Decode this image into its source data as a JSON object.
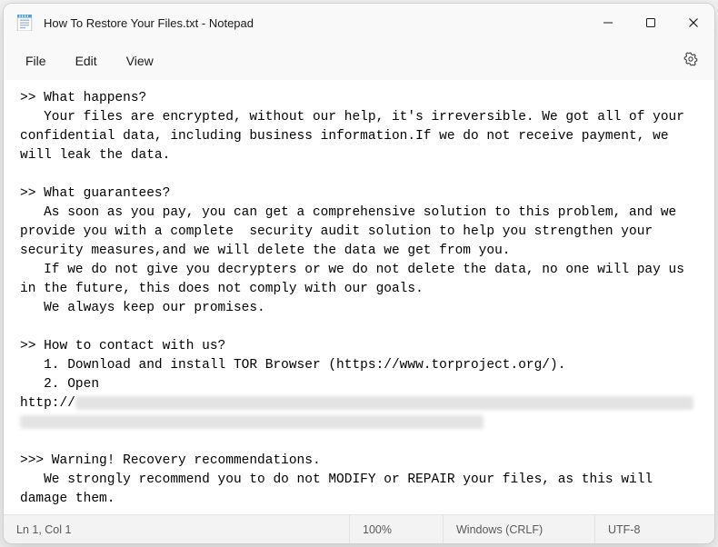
{
  "titlebar": {
    "title": "How To Restore Your Files.txt - Notepad"
  },
  "menubar": {
    "file": "File",
    "edit": "Edit",
    "view": "View"
  },
  "content": {
    "line1": ">> What happens?",
    "line2": "   Your files are encrypted, without our help, it's irreversible. We got all of your confidential data, including business information.If we do not receive payment, we will leak the data.",
    "line3": "",
    "line4": ">> What guarantees?",
    "line5": "   As soon as you pay, you can get a comprehensive solution to this problem, and we provide you with a complete  security audit solution to help you strengthen your security measures,and we will delete the data we get from you.",
    "line6": "   If we do not give you decrypters or we do not delete the data, no one will pay us in the future, this does not comply with our goals.",
    "line7": "   We always keep our promises.",
    "line8": "",
    "line9": ">> How to contact with us?",
    "line10": "   1. Download and install TOR Browser (https://www.torproject.org/).",
    "line11": "   2. Open",
    "line12_prefix": "http://",
    "line13": "",
    "line14": ">>> Warning! Recovery recommendations.",
    "line15": "   We strongly recommend you to do not MODIFY or REPAIR your files, as this will damage them."
  },
  "statusbar": {
    "position": "Ln 1, Col 1",
    "zoom": "100%",
    "line_ending": "Windows (CRLF)",
    "encoding": "UTF-8"
  }
}
